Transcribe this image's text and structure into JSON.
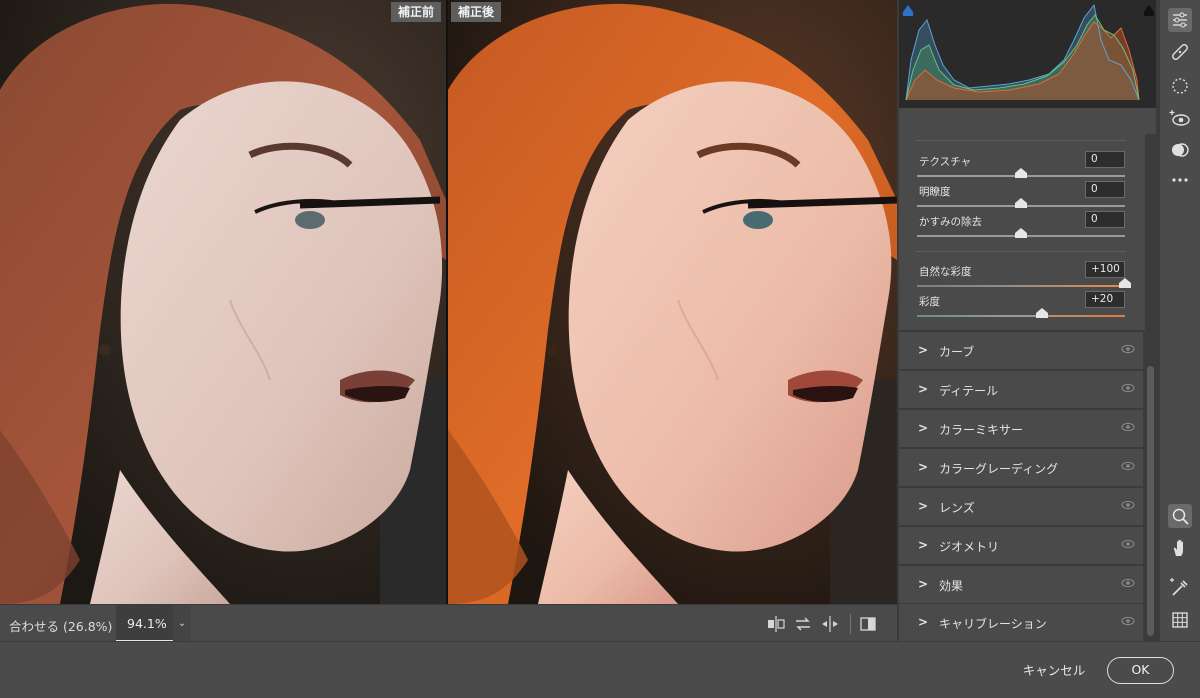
{
  "preview": {
    "before_label": "補正前",
    "after_label": "補正後"
  },
  "preview_bar": {
    "fit_label": "合わせる (26.8%)",
    "zoom_value": "94.1%",
    "zoom_dropdown_icon": "chevron-down-icon",
    "tools": [
      "swap-before-after-icon",
      "copy-settings-icon",
      "flip-settings-icon",
      "toggle-view-icon"
    ]
  },
  "panel": {
    "sliders": [
      {
        "label": "テクスチャ",
        "value": "0",
        "position": 0.5
      },
      {
        "label": "明瞭度",
        "value": "0",
        "position": 0.5
      },
      {
        "label": "かすみの除去",
        "value": "0",
        "position": 0.5
      },
      {
        "label": "自然な彩度",
        "value": "+100",
        "position": 1.0
      },
      {
        "label": "彩度",
        "value": "+20",
        "position": 0.6
      }
    ],
    "sections": [
      {
        "label": "カーブ"
      },
      {
        "label": "ディテール"
      },
      {
        "label": "カラーミキサー"
      },
      {
        "label": "カラーグレーディング"
      },
      {
        "label": "レンズ"
      },
      {
        "label": "ジオメトリ"
      },
      {
        "label": "効果"
      },
      {
        "label": "キャリブレーション"
      }
    ]
  },
  "tool_strip": [
    "edit-sliders-icon",
    "healing-brush-icon",
    "mask-icon",
    "red-eye-icon",
    "presets-icon",
    "more-icon",
    "zoom-icon",
    "hand-icon",
    "color-sampler-icon",
    "grid-icon"
  ],
  "footer": {
    "cancel_label": "キャンセル",
    "ok_label": "OK"
  },
  "colors": {
    "accent_orange": "#e07a35",
    "panel_bg": "#4a4a4a"
  }
}
